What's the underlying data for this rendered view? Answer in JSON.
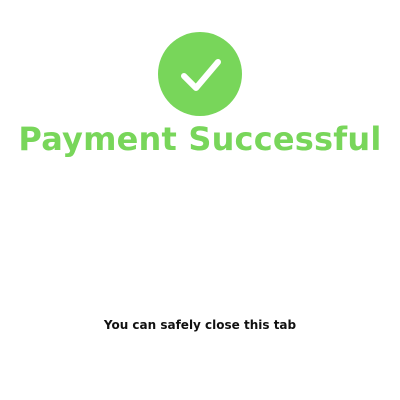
{
  "status": {
    "icon": "checkmark-circle-icon",
    "title": "Payment Successful",
    "message": "You can safely close this tab"
  },
  "colors": {
    "accent": "#78d65a",
    "text": "#111111",
    "background": "#ffffff"
  }
}
